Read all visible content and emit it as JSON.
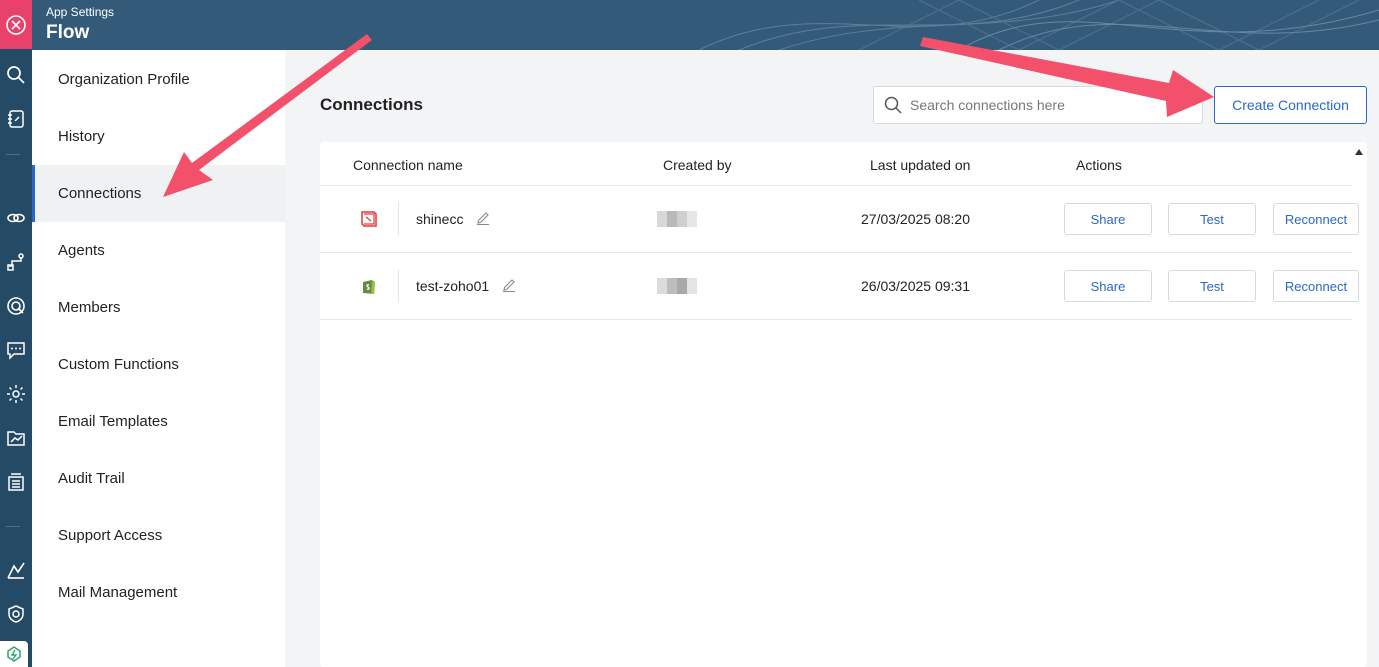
{
  "header": {
    "subtitle": "App Settings",
    "title": "Flow"
  },
  "rail": {
    "icons": [
      "close-icon",
      "search-icon",
      "notebook-icon",
      "link-icon",
      "route-icon",
      "radar-icon",
      "chat-icon",
      "gear-icon",
      "folder-chart-icon",
      "archive-icon",
      "graph-icon",
      "shield-icon",
      "flow-logo-icon"
    ]
  },
  "nav": {
    "items": [
      {
        "label": "Organization Profile"
      },
      {
        "label": "History"
      },
      {
        "label": "Connections"
      },
      {
        "label": "Agents"
      },
      {
        "label": "Members"
      },
      {
        "label": "Custom Functions"
      },
      {
        "label": "Email Templates"
      },
      {
        "label": "Audit Trail"
      },
      {
        "label": "Support Access"
      },
      {
        "label": "Mail Management"
      }
    ],
    "active": "Connections"
  },
  "main": {
    "title": "Connections",
    "search_placeholder": "Search connections here",
    "create_label": "Create Connection"
  },
  "table": {
    "columns": [
      "Connection name",
      "Created by",
      "Last updated on",
      "Actions"
    ],
    "rows": [
      {
        "name": "shinecc",
        "app_icon": "book-icon",
        "updated": "27/03/2025 08:20",
        "actions": [
          "Share",
          "Test",
          "Reconnect"
        ]
      },
      {
        "name": "test-zoho01",
        "app_icon": "shopify-icon",
        "updated": "26/03/2025 09:31",
        "actions": [
          "Share",
          "Test",
          "Reconnect"
        ]
      }
    ]
  },
  "colors": {
    "rail_bg": "#244a66",
    "header_bg": "#345a7a",
    "close_bg": "#e8416b",
    "accent": "#2b67c9",
    "annotation_arrow": "#f2506b"
  }
}
